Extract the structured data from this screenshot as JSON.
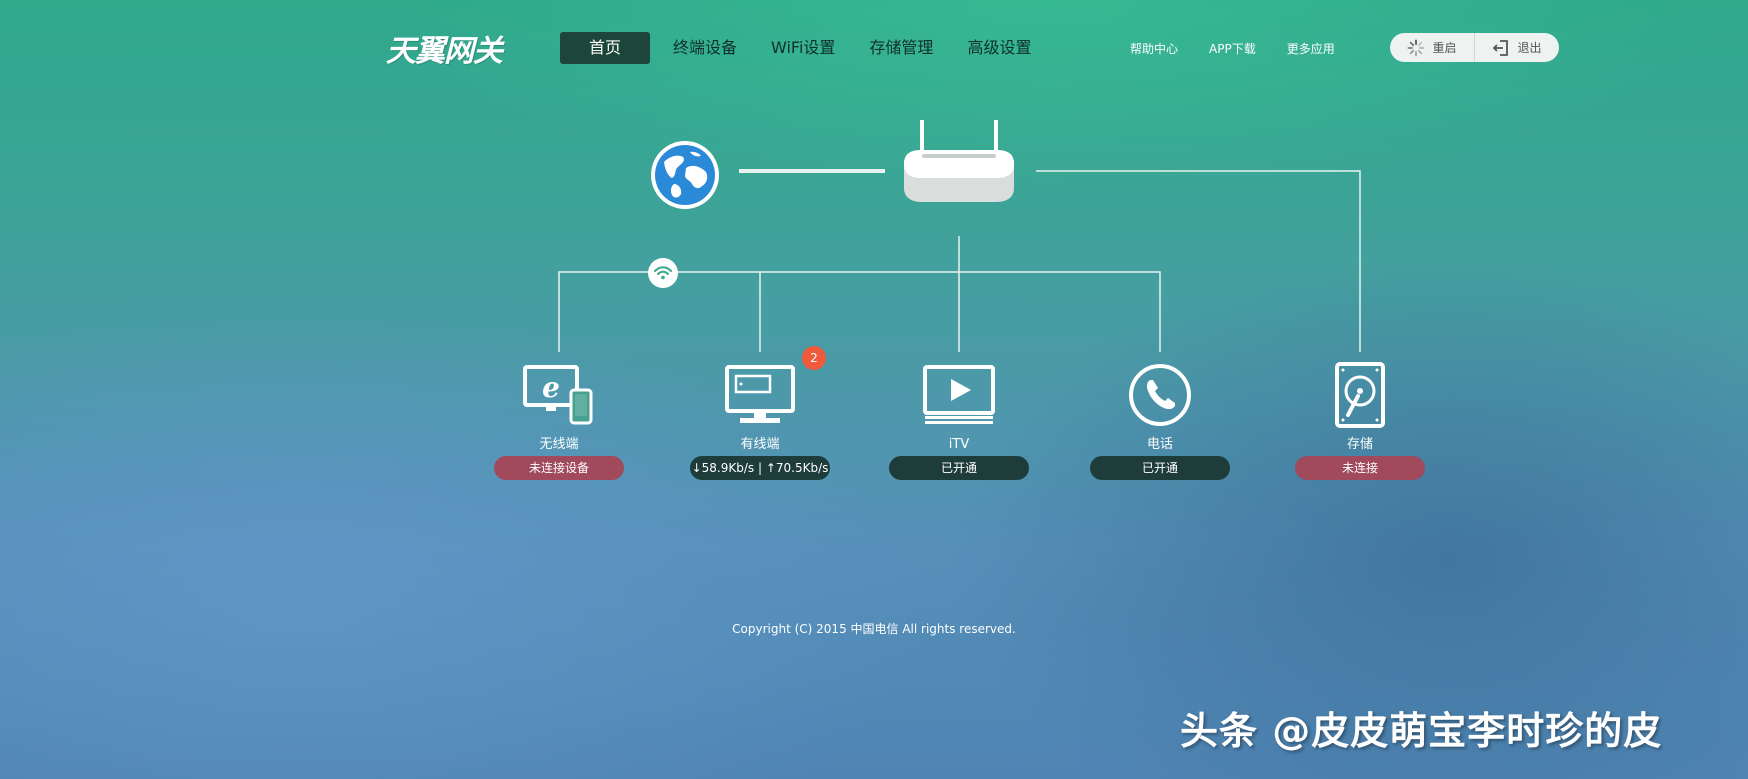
{
  "header": {
    "logo_text": "天翼网关",
    "nav": [
      {
        "label": "首页",
        "active": true
      },
      {
        "label": "终端设备"
      },
      {
        "label": "WiFi设置"
      },
      {
        "label": "存储管理"
      },
      {
        "label": "高级设置"
      }
    ],
    "links": [
      "帮助中心",
      "APP下载",
      "更多应用"
    ],
    "restart_label": "重启",
    "logout_label": "退出"
  },
  "topology": {
    "internet_icon": "globe-icon",
    "gateway_icon": "router-icon",
    "wifi_icon": "wifi-icon",
    "devices": [
      {
        "label": "无线端",
        "status": "未连接设备",
        "state": "disconnected",
        "icon": "wireless-devices-icon"
      },
      {
        "label": "有线端",
        "status": "↓58.9Kb/s | ↑70.5Kb/s",
        "state": "connected",
        "icon": "monitor-icon",
        "badge": "2"
      },
      {
        "label": "iTV",
        "status": "已开通",
        "state": "connected",
        "icon": "tv-play-icon"
      },
      {
        "label": "电话",
        "status": "已开通",
        "state": "connected",
        "icon": "phone-icon"
      },
      {
        "label": "存储",
        "status": "未连接",
        "state": "disconnected",
        "icon": "storage-disk-icon"
      }
    ]
  },
  "footer": {
    "copyright": "Copyright (C) 2015 中国电信 All rights reserved."
  },
  "watermark": "头条 @皮皮萌宝李时珍的皮",
  "colors": {
    "active_nav_bg": "#1d4539",
    "status_disconnected": "#a04a5c",
    "status_connected": "#1e3c3a",
    "badge": "#f05a3c"
  }
}
